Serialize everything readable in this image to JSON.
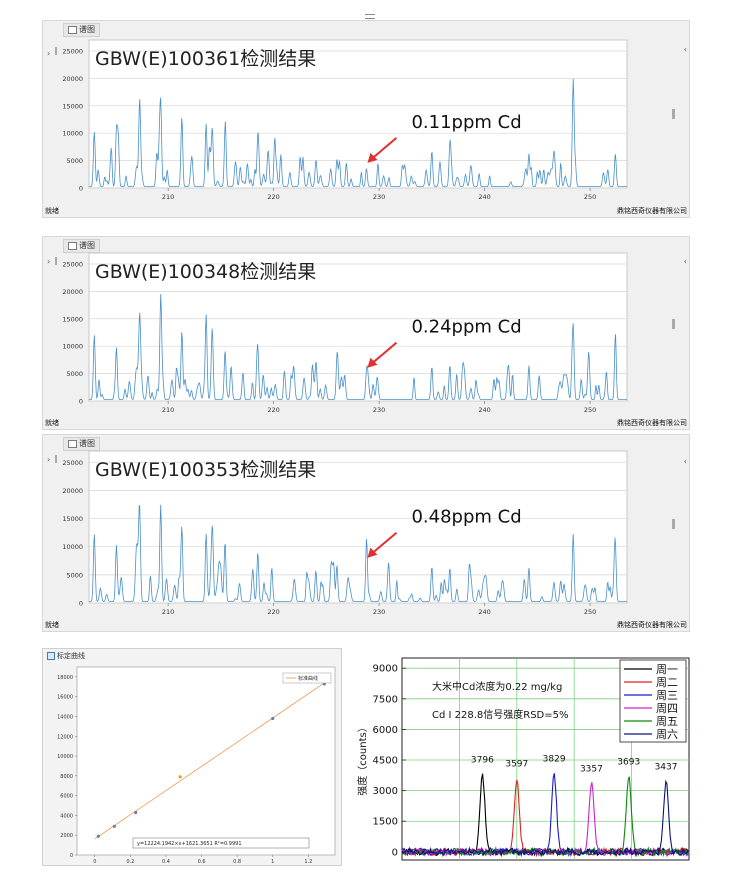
{
  "window_handle": "",
  "colors": {
    "spectrum_line": "#4a90c8",
    "arrow": "#e03030",
    "fit_line": "#e89a50",
    "grid": "#d0d0d0"
  },
  "spectra": [
    {
      "tab_label": "谱图",
      "title": "GBW(E)100361检测结果",
      "annotation": "0.11ppm Cd",
      "status": "就绪",
      "company": "鼎铭西奇仪器有限公司",
      "y_ticks": [
        "25000",
        "20000",
        "15000",
        "10000",
        "5000",
        "0"
      ],
      "x_ticks": [
        "210",
        "220",
        "230",
        "240",
        "250"
      ],
      "cd_peak_x": 228.8,
      "cd_peak_y": 3300
    },
    {
      "tab_label": "谱图",
      "title": "GBW(E)100348检测结果",
      "annotation": "0.24ppm Cd",
      "status": "就绪",
      "company": "鼎铭西奇仪器有限公司",
      "y_ticks": [
        "25000",
        "20000",
        "15000",
        "10000",
        "5000",
        "0"
      ],
      "x_ticks": [
        "210",
        "220",
        "230",
        "240",
        "250"
      ],
      "cd_peak_x": 228.8,
      "cd_peak_y": 4800
    },
    {
      "tab_label": "谱图",
      "title": "GBW(E)100353检测结果",
      "annotation": "0.48ppm Cd",
      "status": "就绪",
      "company": "鼎铭西奇仪器有限公司",
      "y_ticks": [
        "25000",
        "20000",
        "15000",
        "10000",
        "5000",
        "0"
      ],
      "x_ticks": [
        "210",
        "220",
        "230",
        "240",
        "250"
      ],
      "cd_peak_x": 228.8,
      "cd_peak_y": 6800
    }
  ],
  "calibration": {
    "tab_label": "标定曲线",
    "legend": "标准曲线",
    "equation": "y=12224.1942×x+1621.3651      R²=0.9991",
    "y_ticks": [
      "18000",
      "16000",
      "14000",
      "12000",
      "10000",
      "8000",
      "6000",
      "4000",
      "2000",
      "0"
    ],
    "x_ticks": [
      "0",
      "0.2",
      "0.4",
      "0.6",
      "0.8",
      "1",
      "1.2"
    ]
  },
  "chart_data": [
    {
      "type": "line",
      "title": "GBW(E)100361检测结果",
      "xlabel": "",
      "ylabel": "",
      "xlim": [
        202.5,
        253.5
      ],
      "ylim": [
        0,
        27000
      ],
      "annotation": "0.11ppm Cd",
      "major_peaks": {
        "x": [
          203.0,
          205.1,
          207.3,
          209.3,
          211.3,
          213.6,
          214.2,
          215.4,
          218.5,
          224.0,
          226.0,
          228.8,
          235.0,
          236.7,
          244.2,
          248.4,
          252.4
        ],
        "y": [
          10000,
          8000,
          13000,
          15500,
          12000,
          11500,
          10000,
          9000,
          8700,
          4000,
          5000,
          3300,
          6500,
          6200,
          6000,
          19500,
          6000
        ]
      }
    },
    {
      "type": "line",
      "title": "GBW(E)100348检测结果",
      "xlabel": "",
      "ylabel": "",
      "xlim": [
        202.5,
        253.5
      ],
      "ylim": [
        0,
        27000
      ],
      "annotation": "0.24ppm Cd",
      "major_peaks": {
        "x": [
          203.0,
          205.1,
          207.3,
          209.3,
          211.3,
          213.6,
          214.2,
          215.4,
          218.5,
          224.0,
          226.0,
          228.8,
          235.0,
          236.7,
          244.2,
          248.4,
          252.4
        ],
        "y": [
          11800,
          9500,
          14000,
          16800,
          12500,
          12000,
          10000,
          9000,
          8800,
          5200,
          5500,
          4800,
          6000,
          6300,
          6200,
          13500,
          9000
        ]
      }
    },
    {
      "type": "line",
      "title": "GBW(E)100353检测结果",
      "xlabel": "",
      "ylabel": "",
      "xlim": [
        202.5,
        253.5
      ],
      "ylim": [
        0,
        27000
      ],
      "annotation": "0.48ppm Cd",
      "major_peaks": {
        "x": [
          203.0,
          205.1,
          207.3,
          209.3,
          211.3,
          213.6,
          214.2,
          215.4,
          218.5,
          224.0,
          226.0,
          228.8,
          235.0,
          236.7,
          244.2,
          248.4,
          252.4
        ],
        "y": [
          12000,
          10000,
          15000,
          17200,
          12500,
          12000,
          10500,
          9000,
          8800,
          5500,
          6500,
          6800,
          6200,
          6000,
          6000,
          12000,
          7200
        ]
      }
    },
    {
      "type": "scatter",
      "title": "",
      "legend": [
        "标准曲线"
      ],
      "xlim": [
        -0.1,
        1.35
      ],
      "ylim": [
        0,
        19000
      ],
      "x": [
        0.02,
        0.11,
        0.23,
        0.48,
        1.0,
        1.29
      ],
      "y": [
        1900,
        2900,
        4300,
        7900,
        13800,
        17300
      ],
      "fit": {
        "slope": 12224.1942,
        "intercept": 1621.3651,
        "r2": 0.9991
      }
    },
    {
      "type": "line",
      "title": "",
      "ylabel": "强度（counts）",
      "xlim": [
        0,
        1
      ],
      "ylim": [
        -400,
        9500
      ],
      "y_ticks": [
        "9000",
        "7500",
        "6000",
        "4500",
        "3000",
        "1500",
        "0"
      ],
      "annotations": [
        "大米中Cd浓度为0.22 mg/kg",
        "Cd I 228.8信号强度RSD=5%"
      ],
      "series": [
        {
          "name": "周一",
          "color": "#000000",
          "peak_x": 0.28,
          "peak": 3796
        },
        {
          "name": "周二",
          "color": "#e02020",
          "peak_x": 0.4,
          "peak": 3597
        },
        {
          "name": "周三",
          "color": "#1a1ad0",
          "peak_x": 0.53,
          "peak": 3829
        },
        {
          "name": "周四",
          "color": "#d020d0",
          "peak_x": 0.66,
          "peak": 3357
        },
        {
          "name": "周五",
          "color": "#0a8a0a",
          "peak_x": 0.79,
          "peak": 3693
        },
        {
          "name": "周六",
          "color": "#101080",
          "peak_x": 0.92,
          "peak": 3437
        }
      ],
      "peak_labels": [
        "3796",
        "3597",
        "3829",
        "3357",
        "3693",
        "3437"
      ],
      "legend_placement": "top-right"
    }
  ]
}
